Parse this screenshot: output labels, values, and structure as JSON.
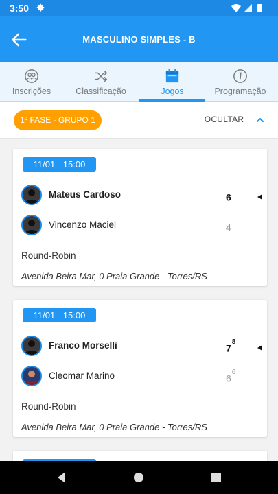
{
  "status_bar": {
    "time": "3:50"
  },
  "app_bar": {
    "title": "MASCULINO SIMPLES - B"
  },
  "tabs": [
    {
      "label": "Inscrições",
      "icon": "people-circle-icon"
    },
    {
      "label": "Classificação",
      "icon": "shuffle-icon"
    },
    {
      "label": "Jogos",
      "icon": "calendar-icon",
      "active": true
    },
    {
      "label": "Programação",
      "icon": "info-circle-icon"
    }
  ],
  "filter": {
    "phase": "1º FASE - GRUPO 1",
    "toggle_label": "OCULTAR"
  },
  "matches": [
    {
      "date": "11/01 - 15:00",
      "player1": {
        "name": "Mateus Cardoso",
        "score": "6",
        "tiebreak": ""
      },
      "player2": {
        "name": "Vincenzo Maciel",
        "score": "4",
        "tiebreak": ""
      },
      "type": "Round-Robin",
      "venue": "Avenida Beira Mar, 0 Praia Grande - Torres/RS"
    },
    {
      "date": "11/01 - 15:00",
      "player1": {
        "name": "Franco Morselli",
        "score": "7",
        "tiebreak": "8"
      },
      "player2": {
        "name": "Cleomar Marino",
        "score": "6",
        "tiebreak": "6"
      },
      "type": "Round-Robin",
      "venue": "Avenida Beira Mar, 0 Praia Grande - Torres/RS"
    }
  ],
  "colors": {
    "primary": "#2196f3",
    "accent": "#ffa000"
  }
}
